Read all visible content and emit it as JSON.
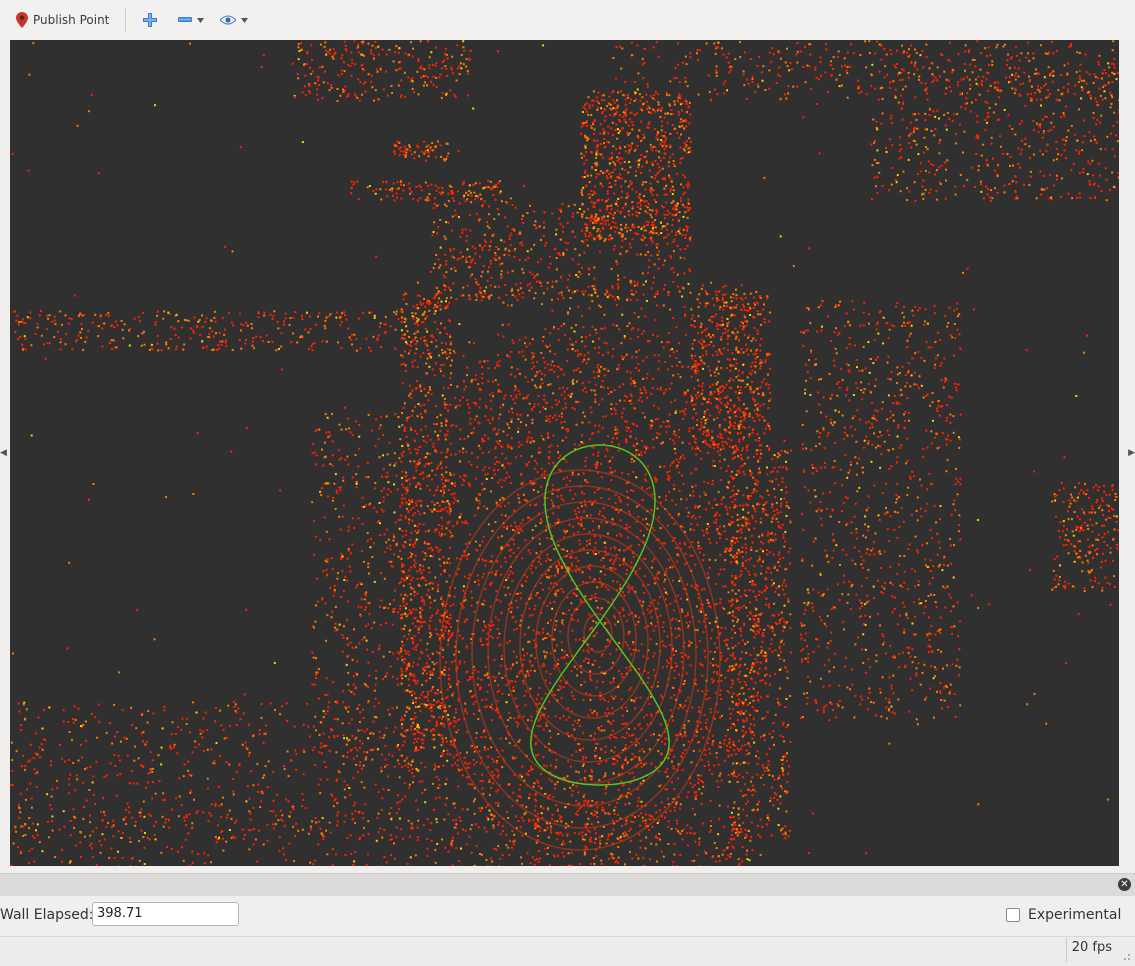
{
  "toolbar": {
    "publish_point_label": "Publish Point",
    "publish_point_icon": "map-pin-icon",
    "add_icon": "plus-icon",
    "remove_icon": "minus-icon",
    "view_icon": "eye-icon"
  },
  "panel": {
    "wall_elapsed_label": "Wall Elapsed:",
    "wall_elapsed_value": "398.71",
    "experimental_label": "Experimental",
    "experimental_checked": false
  },
  "status": {
    "fps": "20 fps"
  },
  "colors": {
    "viewport_bg": "#303030",
    "points_red": "#ff2200",
    "points_orange": "#ff7a00",
    "points_yellow": "#ffd000",
    "trajectory": "#55cc22"
  }
}
